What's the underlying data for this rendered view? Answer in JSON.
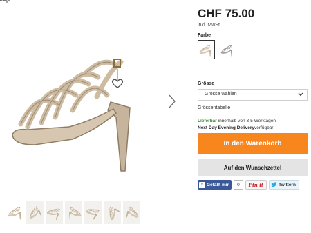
{
  "breadcrumb": "elega",
  "product": {
    "price": "CHF 75.00",
    "tax_note": "inkl. MwSt.",
    "color_label": "Farbe",
    "size_label": "Grösse",
    "size_select_value": "Grösse wählen",
    "size_table_link": "Grössentabelle",
    "delivery_available": "Lieferbar",
    "delivery_time": " innerhalb von 3-5 Werktagen",
    "next_day_label": "Next Day Evening Delivery",
    "next_day_status": "verfügbar",
    "cart_button": "In den Warenkorb",
    "wishlist_button": "Auf den Wunschzettel"
  },
  "social": {
    "facebook_label": "Gefällt mir",
    "facebook_count": "0",
    "pinterest_label": "Pin it",
    "twitter_label": "Twittern"
  },
  "icons": {
    "next": "chevron-right-icon",
    "select": "chevron-down-icon",
    "facebook": "facebook-icon",
    "twitter": "twitter-bird-icon"
  },
  "colors": {
    "accent_orange": "#f7861e",
    "available_green": "#2f8a2f",
    "facebook_blue": "#3b5998",
    "pinterest_red": "#c8232c"
  }
}
